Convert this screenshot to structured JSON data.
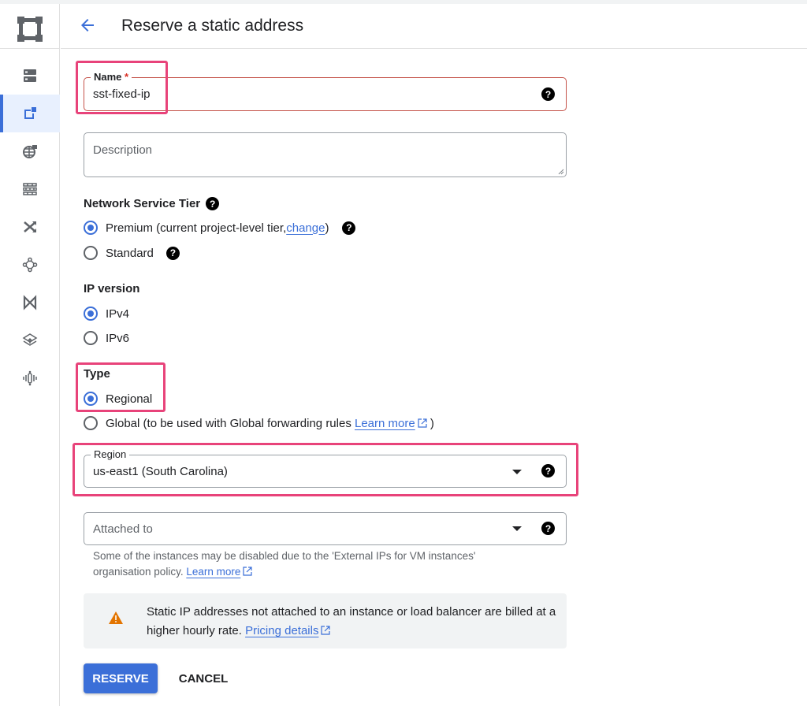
{
  "header": {
    "title": "Reserve a static address",
    "back_icon": "arrow-left-icon"
  },
  "rail": {
    "logo_icon": "vpc-network-logo-icon",
    "items": [
      {
        "icon": "vpc-networks-icon",
        "active": false
      },
      {
        "icon": "ip-addresses-icon",
        "active": true
      },
      {
        "icon": "internal-ranges-icon",
        "active": false
      },
      {
        "icon": "firewall-icon",
        "active": false
      },
      {
        "icon": "routes-icon",
        "active": false
      },
      {
        "icon": "network-peering-icon",
        "active": false
      },
      {
        "icon": "shared-vpc-icon",
        "active": false
      },
      {
        "icon": "serverless-vpc-access-icon",
        "active": false
      },
      {
        "icon": "packet-mirroring-icon",
        "active": false
      }
    ]
  },
  "form": {
    "name": {
      "label": "Name",
      "required_mark": "*",
      "value": "sst-fixed-ip",
      "help_icon": "?"
    },
    "description": {
      "placeholder": "Description",
      "value": ""
    },
    "network_tier": {
      "label": "Network Service Tier",
      "options": [
        {
          "label_prefix": "Premium (current project-level tier, ",
          "link": "change",
          "label_suffix": ")",
          "checked": true
        },
        {
          "label": "Standard",
          "checked": false
        }
      ]
    },
    "ip_version": {
      "label": "IP version",
      "options": [
        {
          "label": "IPv4",
          "checked": true
        },
        {
          "label": "IPv6",
          "checked": false
        }
      ]
    },
    "type": {
      "label": "Type",
      "options": [
        {
          "label": "Regional",
          "checked": true
        },
        {
          "label_prefix": "Global (to be used with Global forwarding rules ",
          "link": "Learn more",
          "label_suffix": " )",
          "checked": false
        }
      ]
    },
    "region": {
      "label": "Region",
      "value": "us-east1 (South Carolina)"
    },
    "attached_to": {
      "placeholder": "Attached to",
      "value": "",
      "hint_text": "Some of the instances may be disabled due to the 'External IPs for VM instances' organisation policy. ",
      "hint_link": "Learn more"
    },
    "warning": {
      "text": "Static IP addresses not attached to an instance or load balancer are billed at a higher hourly rate. ",
      "link": "Pricing details",
      "color": "#e37400"
    },
    "actions": {
      "reserve": "RESERVE",
      "cancel": "CANCEL"
    }
  },
  "colors": {
    "accent": "#3b6fd8",
    "highlight": "#e8437a",
    "error_border": "#c5534a"
  }
}
